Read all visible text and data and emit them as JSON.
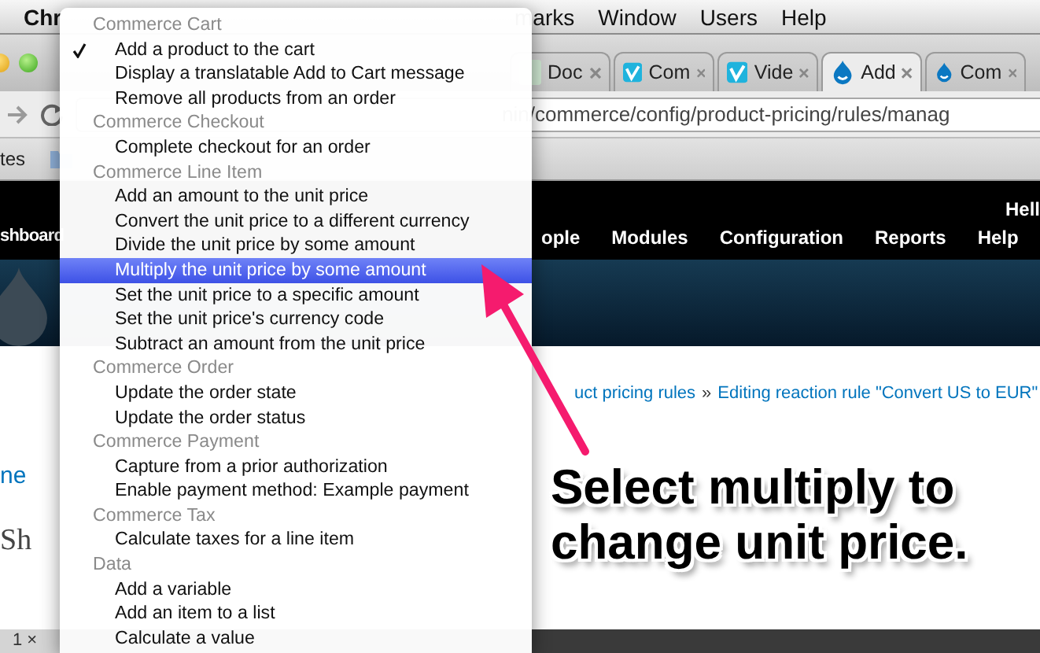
{
  "menu_bar": {
    "app": "Chr",
    "items": [
      "marks",
      "Window",
      "Users",
      "Help"
    ]
  },
  "tabs": [
    {
      "label": "Doc",
      "kind": "document",
      "selected": false
    },
    {
      "label": "Com",
      "kind": "vimeo",
      "selected": false
    },
    {
      "label": "Vide",
      "kind": "vimeo",
      "selected": false
    },
    {
      "label": "Add",
      "kind": "drupal",
      "selected": true
    },
    {
      "label": "Com",
      "kind": "drupal",
      "selected": false
    }
  ],
  "address_bar": {
    "value": "nin/commerce/config/product-pricing/rules/manag"
  },
  "bookmarks_bar": {
    "items": [
      "tes"
    ]
  },
  "admin_toolbar": {
    "greeting": "Hell"
  },
  "nav": {
    "items": [
      "shboard",
      "ople",
      "Modules",
      "Configuration",
      "Reports",
      "Help"
    ]
  },
  "breadcrumb": {
    "items": [
      "uct pricing rules",
      "Editing reaction rule \"Convert US to EUR\""
    ],
    "separator": "»"
  },
  "page_fragments": {
    "link": "ne",
    "heading": "Sh",
    "pager": "1 ×"
  },
  "context_menu": {
    "groups": [
      {
        "label": "Commerce Cart",
        "items": [
          {
            "label": "Add a product to the cart",
            "checked": true,
            "selected": false
          },
          {
            "label": "Display a translatable Add to Cart message",
            "checked": false,
            "selected": false
          },
          {
            "label": "Remove all products from an order",
            "checked": false,
            "selected": false
          }
        ]
      },
      {
        "label": "Commerce Checkout",
        "items": [
          {
            "label": "Complete checkout for an order",
            "checked": false,
            "selected": false
          }
        ]
      },
      {
        "label": "Commerce Line Item",
        "items": [
          {
            "label": "Add an amount to the unit price",
            "checked": false,
            "selected": false
          },
          {
            "label": "Convert the unit price to a different currency",
            "checked": false,
            "selected": false
          },
          {
            "label": "Divide the unit price by some amount",
            "checked": false,
            "selected": false
          },
          {
            "label": "Multiply the unit price by some amount",
            "checked": false,
            "selected": true
          },
          {
            "label": "Set the unit price to a specific amount",
            "checked": false,
            "selected": false
          },
          {
            "label": "Set the unit price's currency code",
            "checked": false,
            "selected": false
          },
          {
            "label": "Subtract an amount from the unit price",
            "checked": false,
            "selected": false
          }
        ]
      },
      {
        "label": "Commerce Order",
        "items": [
          {
            "label": "Update the order state",
            "checked": false,
            "selected": false
          },
          {
            "label": "Update the order status",
            "checked": false,
            "selected": false
          }
        ]
      },
      {
        "label": "Commerce Payment",
        "items": [
          {
            "label": "Capture from a prior authorization",
            "checked": false,
            "selected": false
          },
          {
            "label": "Enable payment method: Example payment",
            "checked": false,
            "selected": false
          }
        ]
      },
      {
        "label": "Commerce Tax",
        "items": [
          {
            "label": "Calculate taxes for a line item",
            "checked": false,
            "selected": false
          }
        ]
      },
      {
        "label": "Data",
        "items": [
          {
            "label": "Add a variable",
            "checked": false,
            "selected": false
          },
          {
            "label": "Add an item to a list",
            "checked": false,
            "selected": false
          },
          {
            "label": "Calculate a value",
            "checked": false,
            "selected": false
          }
        ]
      }
    ]
  },
  "annotation": {
    "text": "Select multiply to change unit price."
  }
}
